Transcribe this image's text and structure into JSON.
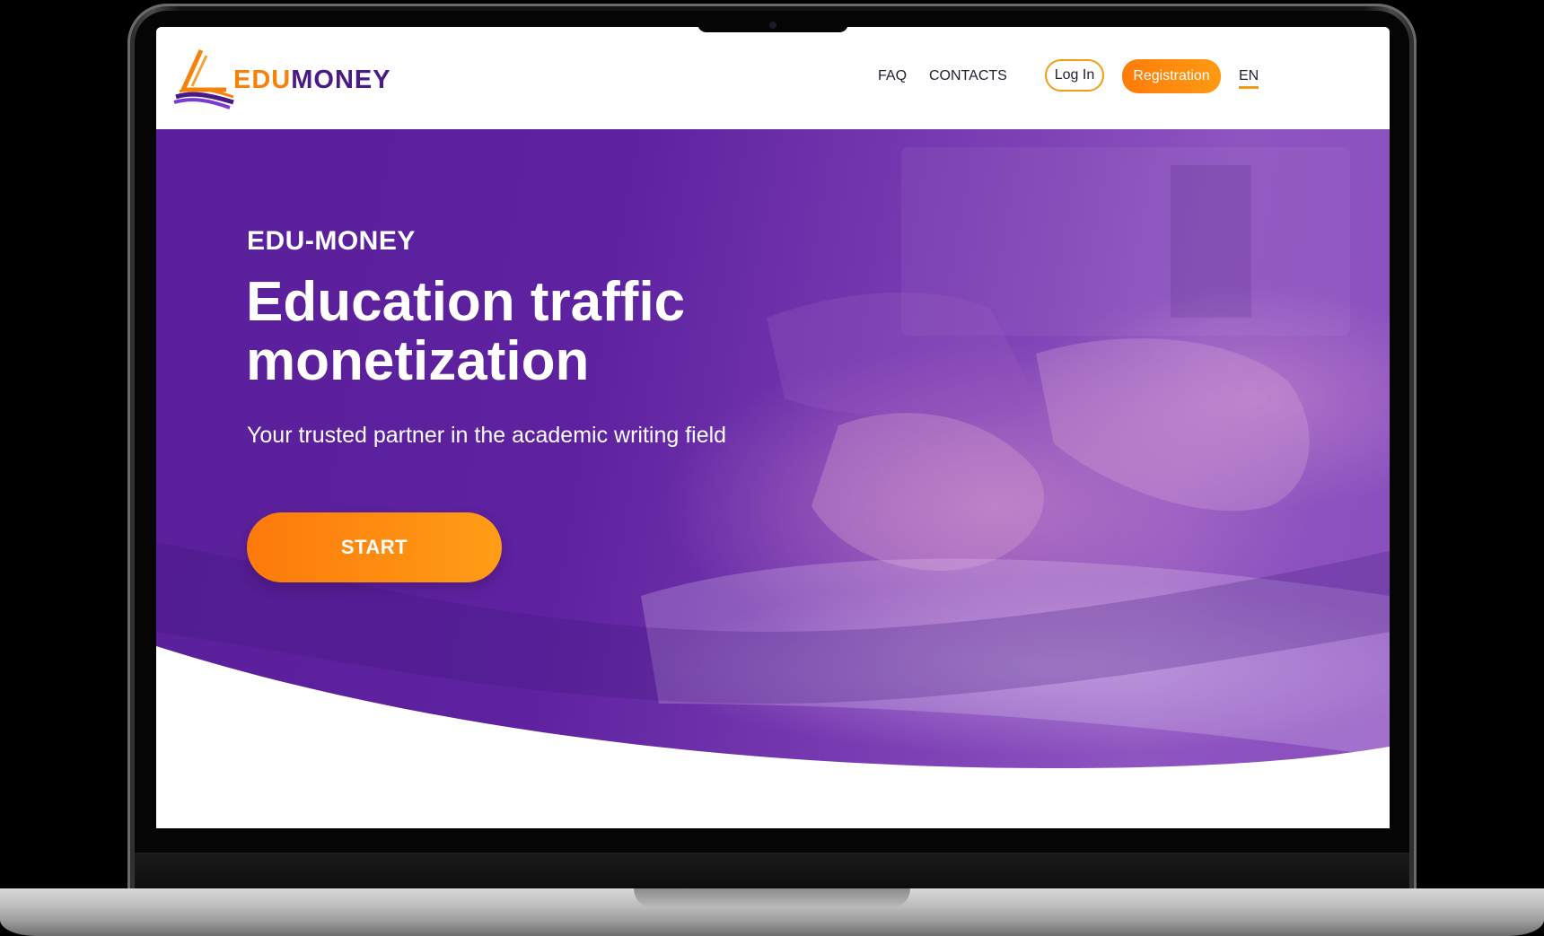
{
  "header": {
    "logo": {
      "part1": "EDU",
      "part2": "MONEY"
    },
    "nav": {
      "faq": "FAQ",
      "contacts": "CONTACTS"
    },
    "login_label": "Log In",
    "registration_label": "Registration",
    "language": "EN"
  },
  "hero": {
    "eyebrow": "EDU-MONEY",
    "title": "Education traffic monetization",
    "subtitle": "Your trusted partner in the academic writing field",
    "cta_label": "START"
  },
  "colors": {
    "accent_orange": "#fd7c0c",
    "brand_purple": "#4a1a86",
    "hero_purple": "#5e22a0"
  }
}
